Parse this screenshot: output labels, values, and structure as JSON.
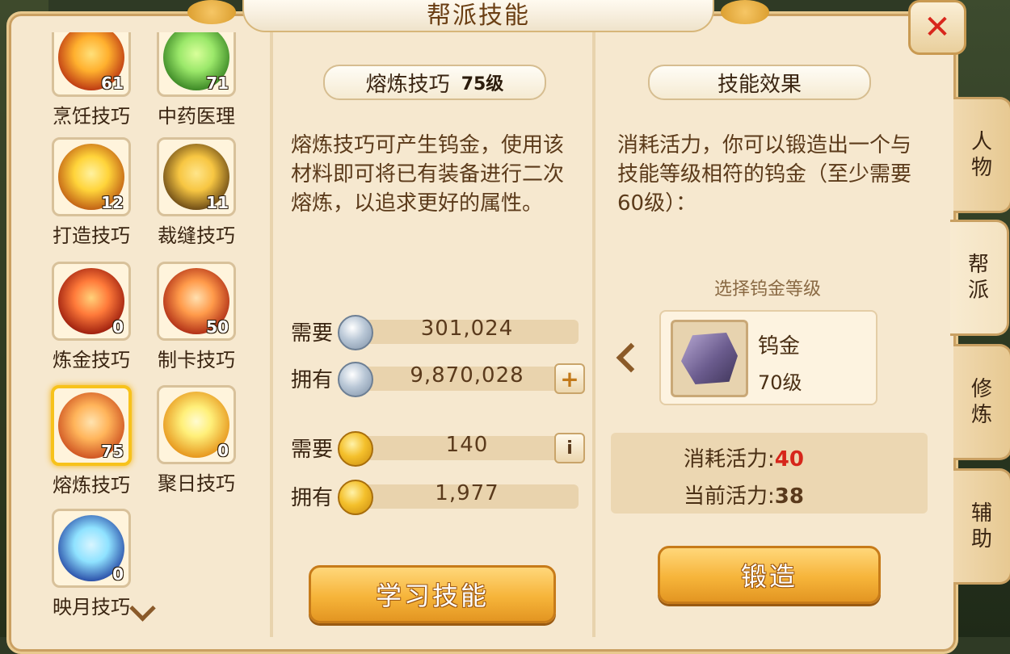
{
  "window": {
    "title": "帮派技能"
  },
  "skills": [
    {
      "name": "烹饪技巧",
      "level": "61",
      "color_a": "#ffb02e",
      "color_b": "#b3280f",
      "selected": false
    },
    {
      "name": "中药医理",
      "level": "71",
      "color_a": "#9be86a",
      "color_b": "#2e7a1b",
      "selected": false
    },
    {
      "name": "打造技巧",
      "level": "12",
      "color_a": "#ffd43a",
      "color_b": "#b8500f",
      "selected": false
    },
    {
      "name": "裁缝技巧",
      "level": "11",
      "color_a": "#f7c642",
      "color_b": "#5a3a10",
      "selected": false
    },
    {
      "name": "炼金技巧",
      "level": "0",
      "color_a": "#ff7a3a",
      "color_b": "#8f1208",
      "selected": false
    },
    {
      "name": "制卡技巧",
      "level": "50",
      "color_a": "#ff9a4a",
      "color_b": "#a5200f",
      "selected": false
    },
    {
      "name": "熔炼技巧",
      "level": "75",
      "color_a": "#ffb45a",
      "color_b": "#c8471a",
      "selected": true
    },
    {
      "name": "聚日技巧",
      "level": "0",
      "color_a": "#fff07a",
      "color_b": "#e38a10",
      "selected": false
    },
    {
      "name": "映月技巧",
      "level": "0",
      "color_a": "#8fe2ff",
      "color_b": "#1c3a9c",
      "selected": false
    }
  ],
  "detail": {
    "skill_name": "熔炼技巧",
    "skill_level": "75级",
    "description": "熔炼技巧可产生钨金，使用该材料即可将已有装备进行二次熔炼，以追求更好的属性。",
    "silver_required_label": "需要",
    "silver_required": "301,024",
    "silver_owned_label": "拥有",
    "silver_owned": "9,870,028",
    "contrib_required_label": "需要",
    "contrib_required": "140",
    "contrib_owned_label": "拥有",
    "contrib_owned": "1,977",
    "add_button": "+",
    "info_button": "i",
    "learn_button": "学习技能"
  },
  "effect": {
    "title": "技能效果",
    "description": "消耗活力，你可以锻造出一个与技能等级相符的钨金（至少需要60级）：",
    "select_label": "选择钨金等级",
    "item_name": "钨金",
    "item_level": "70级",
    "cost_label": "消耗活力:",
    "cost_value": "40",
    "current_label": "当前活力:",
    "current_value": "38",
    "forge_button": "锻造"
  },
  "side_tabs": [
    {
      "label": "人物",
      "active": false
    },
    {
      "label": "帮派",
      "active": true
    },
    {
      "label": "修炼",
      "active": false
    },
    {
      "label": "辅助",
      "active": false
    }
  ],
  "colors": {
    "accent_gold": "#f6b43a",
    "danger_red": "#d6261b",
    "panel_bg": "#f6e8cf"
  }
}
